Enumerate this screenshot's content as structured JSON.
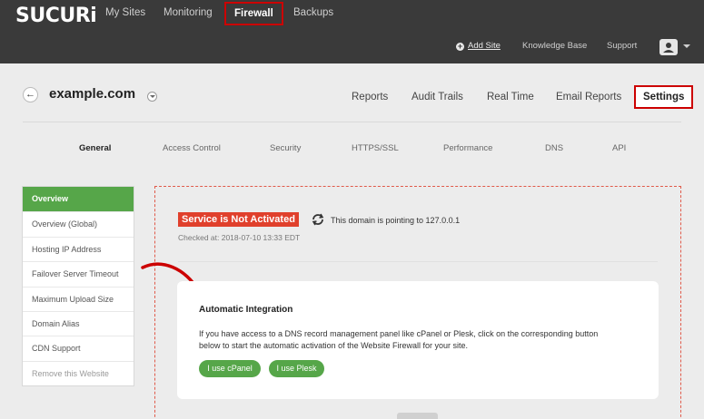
{
  "brand": {
    "logo": "SUCURi"
  },
  "topnav": {
    "items": [
      "My Sites",
      "Monitoring",
      "Firewall",
      "Backups"
    ],
    "active": "Firewall"
  },
  "subnav": {
    "add_site": "Add Site",
    "knowledge_base": "Knowledge Base",
    "support": "Support"
  },
  "site": {
    "title": "example.com"
  },
  "mainnav": {
    "items": [
      "Reports",
      "Audit Trails",
      "Real Time",
      "Email Reports",
      "Settings"
    ],
    "active": "Settings"
  },
  "subtabs": {
    "items": [
      "General",
      "Access Control",
      "Security",
      "HTTPS/SSL",
      "Performance",
      "DNS",
      "API"
    ],
    "active": "General"
  },
  "sidebar": {
    "items": [
      {
        "label": "Overview"
      },
      {
        "label": "Overview (Global)"
      },
      {
        "label": "Hosting IP Address"
      },
      {
        "label": "Failover Server Timeout"
      },
      {
        "label": "Maximum Upload Size"
      },
      {
        "label": "Domain Alias"
      },
      {
        "label": "CDN Support"
      },
      {
        "label": "Remove this Website"
      }
    ]
  },
  "status": {
    "badge": "Service is Not Activated",
    "pointing": "This domain is pointing to 127.0.0.1",
    "checked": "Checked at: 2018-07-10 13:33 EDT"
  },
  "integration": {
    "title": "Automatic Integration",
    "line1": "If you have access to a DNS record management panel like cPanel or Plesk, click on the corresponding button",
    "line2": "below to start the automatic activation of the Website Firewall for your site.",
    "cpanel_button": "I use cPanel",
    "plesk_button": "I use Plesk"
  },
  "colors": {
    "topbar": "#3a3a3a",
    "accent_green": "#56a649",
    "alert_red": "#e0402c",
    "highlight_box": "#cc0000"
  }
}
